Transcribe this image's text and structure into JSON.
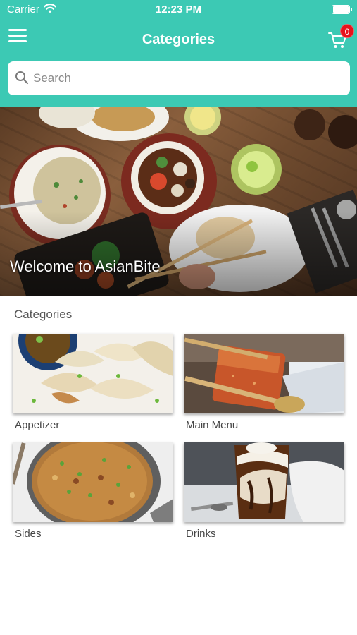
{
  "status_bar": {
    "carrier": "Carrier",
    "time": "12:23 PM"
  },
  "nav": {
    "title": "Categories",
    "cart_count": "0",
    "menu_icon": "hamburger-menu-icon",
    "cart_icon": "shopping-cart-icon"
  },
  "search": {
    "placeholder": "Search",
    "icon": "search-icon"
  },
  "hero": {
    "title": "Welcome to AsianBite"
  },
  "categories": {
    "heading": "Categories",
    "items": [
      {
        "label": "Appetizer"
      },
      {
        "label": "Main Menu"
      },
      {
        "label": "Sides"
      },
      {
        "label": "Drinks"
      }
    ]
  },
  "colors": {
    "header": "#3cc9b4",
    "badge": "#e8121b"
  }
}
